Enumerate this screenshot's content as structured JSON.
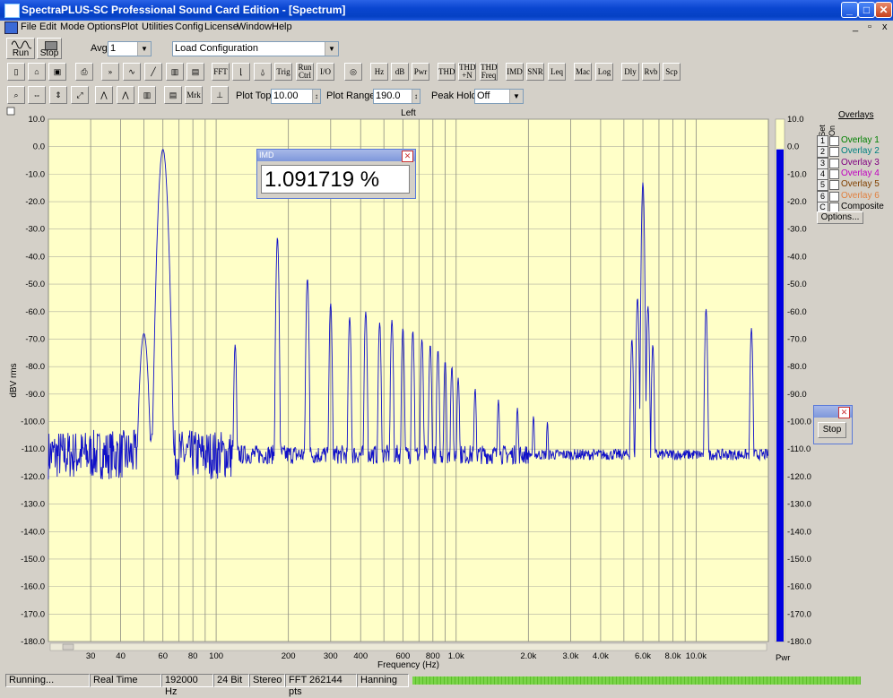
{
  "window": {
    "title": "SpectraPLUS-SC Professional Sound Card Edition - [Spectrum]",
    "min": "_",
    "max": "□",
    "close": "✕"
  },
  "menu": [
    "File",
    "Edit",
    "Mode",
    "Options",
    "Plot",
    "Utilities",
    "Config",
    "License",
    "Window",
    "Help"
  ],
  "mdi": {
    "min": "_",
    "restore": "▫",
    "close": "x"
  },
  "toolbar1": {
    "run_label": "Run",
    "stop_label": "Stop",
    "avg_label": "Avg",
    "avg_value": "1",
    "config_value": "Load Configuration"
  },
  "toolbar2": {
    "buttons": [
      "FFT",
      "Trig",
      "Run Ctrl",
      "I/O",
      "Hz",
      "dB",
      "Pwr",
      "THD",
      "THD +N",
      "THD Freq",
      "IMD",
      "SNR",
      "Leq",
      "Mac",
      "Log",
      "Dly",
      "Rvb",
      "Scp"
    ]
  },
  "toolbar3": {
    "mrk": "Mrk",
    "plot_top_label": "Plot Top:",
    "plot_top_value": "10.00",
    "plot_range_label": "Plot Range:",
    "plot_range_value": "190.0",
    "peak_hold_label": "Peak Hold:",
    "peak_hold_value": "Off"
  },
  "overlays": {
    "header": "Overlays",
    "set_label": "Set",
    "on_label": "On",
    "items": [
      {
        "num": "1",
        "name": "Overlay 1",
        "color": "#008000"
      },
      {
        "num": "2",
        "name": "Overlay 2",
        "color": "#008080"
      },
      {
        "num": "3",
        "name": "Overlay 3",
        "color": "#800080"
      },
      {
        "num": "4",
        "name": "Overlay 4",
        "color": "#c000c0"
      },
      {
        "num": "5",
        "name": "Overlay 5",
        "color": "#804000"
      },
      {
        "num": "6",
        "name": "Overlay 6",
        "color": "#e08040"
      },
      {
        "num": "C",
        "name": "Composite",
        "color": "#000000"
      }
    ],
    "options_label": "Options..."
  },
  "imd_window": {
    "title": "IMD",
    "value": "1.091719 %"
  },
  "stop_window": {
    "button": "Stop"
  },
  "status": [
    "Running...",
    "Real Time",
    "192000 Hz",
    "24 Bit",
    "Stereo",
    "FFT 262144 pts",
    "Hanning"
  ],
  "chart_data": {
    "type": "line",
    "title": "Left",
    "xlabel": "Frequency (Hz)",
    "ylabel": "dBV rms",
    "x_scale": "log",
    "xlim": [
      20,
      20000
    ],
    "ylim": [
      -180,
      10
    ],
    "yticks": [
      "10.0",
      "0.0",
      "-10.0",
      "-20.0",
      "-30.0",
      "-40.0",
      "-50.0",
      "-60.0",
      "-70.0",
      "-80.0",
      "-90.0",
      "-100.0",
      "-110.0",
      "-120.0",
      "-130.0",
      "-140.0",
      "-150.0",
      "-160.0",
      "-170.0",
      "-180.0"
    ],
    "xticks": [
      {
        "v": 30,
        "l": "30"
      },
      {
        "v": 40,
        "l": "40"
      },
      {
        "v": 60,
        "l": "60"
      },
      {
        "v": 80,
        "l": "80"
      },
      {
        "v": 100,
        "l": "100"
      },
      {
        "v": 200,
        "l": "200"
      },
      {
        "v": 300,
        "l": "300"
      },
      {
        "v": 400,
        "l": "400"
      },
      {
        "v": 600,
        "l": "600"
      },
      {
        "v": 800,
        "l": "800"
      },
      {
        "v": 1000,
        "l": "1.0k"
      },
      {
        "v": 2000,
        "l": "2.0k"
      },
      {
        "v": 3000,
        "l": "3.0k"
      },
      {
        "v": 4000,
        "l": "4.0k"
      },
      {
        "v": 6000,
        "l": "6.0k"
      },
      {
        "v": 8000,
        "l": "8.0k"
      },
      {
        "v": 10000,
        "l": "10.0k"
      }
    ],
    "noise_floor": -112,
    "peaks": [
      {
        "f": 50,
        "db": -68
      },
      {
        "f": 60,
        "db": -1
      },
      {
        "f": 120,
        "db": -72
      },
      {
        "f": 180,
        "db": -33
      },
      {
        "f": 240,
        "db": -48
      },
      {
        "f": 300,
        "db": -57
      },
      {
        "f": 360,
        "db": -62
      },
      {
        "f": 420,
        "db": -60
      },
      {
        "f": 480,
        "db": -64
      },
      {
        "f": 540,
        "db": -63
      },
      {
        "f": 600,
        "db": -66
      },
      {
        "f": 660,
        "db": -67
      },
      {
        "f": 720,
        "db": -70
      },
      {
        "f": 780,
        "db": -72
      },
      {
        "f": 840,
        "db": -74
      },
      {
        "f": 900,
        "db": -78
      },
      {
        "f": 960,
        "db": -80
      },
      {
        "f": 1020,
        "db": -84
      },
      {
        "f": 1200,
        "db": -88
      },
      {
        "f": 1500,
        "db": -92
      },
      {
        "f": 1800,
        "db": -95
      },
      {
        "f": 2100,
        "db": -98
      },
      {
        "f": 2400,
        "db": -100
      },
      {
        "f": 6000,
        "db": -13
      },
      {
        "f": 5700,
        "db": -55
      },
      {
        "f": 6300,
        "db": -58
      },
      {
        "f": 5400,
        "db": -70
      },
      {
        "f": 6600,
        "db": -72
      },
      {
        "f": 11000,
        "db": -59
      },
      {
        "f": 17000,
        "db": -66
      }
    ],
    "level_meter": {
      "label": "Pwr",
      "value_db": -1
    }
  }
}
